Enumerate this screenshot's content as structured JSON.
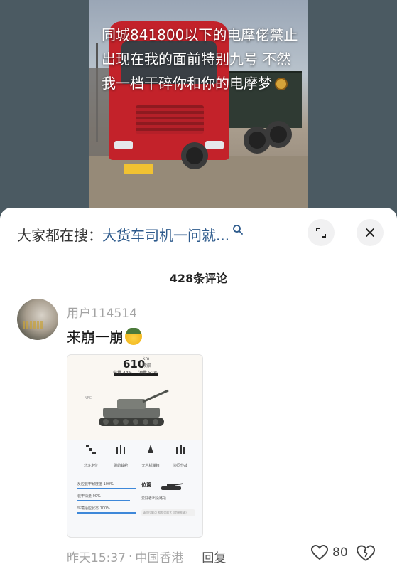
{
  "video": {
    "overlay_caption": "同城841800以下的电摩佬禁止出现在我的面前特别九号 不然我一档干碎你和你的电摩梦"
  },
  "sheet": {
    "search_prefix": "大家都在搜：",
    "search_query": "大货车司机一问就...",
    "comment_count_label": "428条评论"
  },
  "comment": {
    "username": "用户114514",
    "text": "来崩一崩",
    "time": "昨天15:37",
    "location": "中国香港",
    "reply_label": "回复",
    "like_count": "80",
    "attachment": {
      "range_value": "610",
      "range_unit": "km",
      "range_sub": "续航",
      "battery_label": "电量 44%",
      "fuel_label": "油量 52%",
      "nfc_label": "NFC",
      "tiles": [
        "北斗定位",
        "弹药载舱",
        "无人机弹箱",
        "协同作战"
      ],
      "list_items": [
        "反应装甲耐度值 100%",
        "装甲油量 90%",
        "环境适应状态 100%"
      ],
      "list_levels": [
        1.0,
        0.9,
        1.0
      ],
      "position_heading": "位置",
      "position_text": "爱好者出没路段",
      "position_sub": "请你位解点 和相信的大 (提醒准确)"
    }
  },
  "colors": {
    "accent_link": "#2d5a8c",
    "muted_text": "#a3a3a3",
    "video_bg": "#4b5a62"
  },
  "icons": {
    "search": "search-icon",
    "expand": "expand-icon",
    "close": "close-icon",
    "like": "heart-outline-icon",
    "dislike": "broken-heart-icon"
  }
}
